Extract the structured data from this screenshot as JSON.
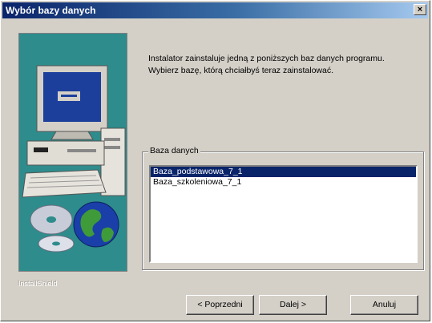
{
  "window": {
    "title": "Wybór bazy danych",
    "close_label": "×"
  },
  "instructions": {
    "line1": "Instalator zainstaluje jedną z poniższych baz danych programu.",
    "line2": "Wybierz bazę, którą chciałbyś teraz zainstalować."
  },
  "group": {
    "label": "Baza danych",
    "items": [
      {
        "label": "Baza_podstawowa_7_1",
        "selected": true
      },
      {
        "label": "Baza_szkoleniowa_7_1",
        "selected": false
      }
    ]
  },
  "brand": "InstallShield",
  "buttons": {
    "back": "< Poprzedni",
    "next": "Dalej >",
    "cancel": "Anuluj"
  },
  "colors": {
    "side_panel": "#2e8c8c",
    "selection": "#0a246a",
    "title_start": "#0a246a"
  }
}
